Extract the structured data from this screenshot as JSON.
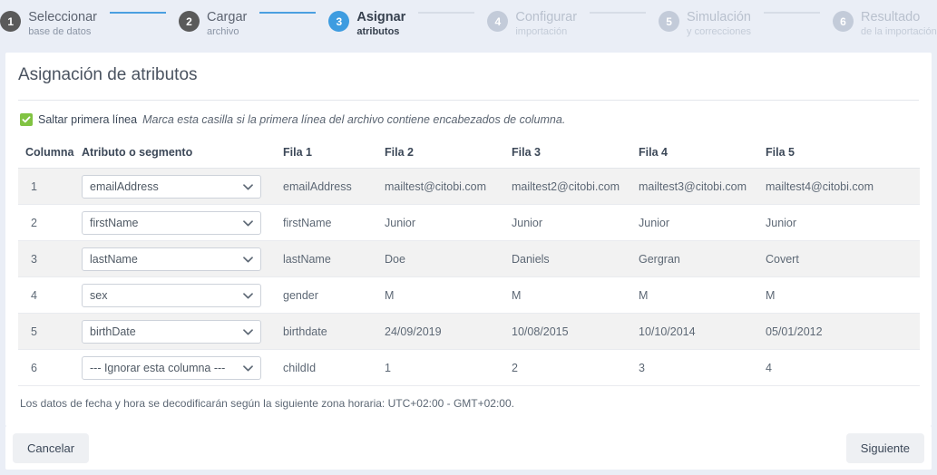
{
  "stepper": {
    "steps": [
      {
        "num": "1",
        "title": "Seleccionar",
        "sub": "base de datos",
        "state": "done"
      },
      {
        "num": "2",
        "title": "Cargar",
        "sub": "archivo",
        "state": "done"
      },
      {
        "num": "3",
        "title": "Asignar",
        "sub": "atributos",
        "state": "active"
      },
      {
        "num": "4",
        "title": "Configurar",
        "sub": "importación",
        "state": "todo"
      },
      {
        "num": "5",
        "title": "Simulación",
        "sub": "y correcciones",
        "state": "todo"
      },
      {
        "num": "6",
        "title": "Resultado",
        "sub": "de la importación",
        "state": "todo"
      }
    ],
    "accent_done": "#4a9fe0",
    "accent_active": "#3e9ce0",
    "accent_todo": "#c3cbd9"
  },
  "page": {
    "title": "Asignación de atributos"
  },
  "skip_first_line": {
    "checked": true,
    "label": "Saltar primera línea",
    "hint": "Marca esta casilla si la primera línea del archivo contiene encabezados de columna.",
    "check_color": "#81c342"
  },
  "table": {
    "headers": [
      "Columna",
      "Atributo o segmento",
      "Fila 1",
      "Fila 2",
      "Fila 3",
      "Fila 4",
      "Fila 5"
    ],
    "rows": [
      {
        "num": "1",
        "attribute": "emailAddress",
        "cells": [
          "emailAddress",
          "mailtest@citobi.com",
          "mailtest2@citobi.com",
          "mailtest3@citobi.com",
          "mailtest4@citobi.com"
        ]
      },
      {
        "num": "2",
        "attribute": "firstName",
        "cells": [
          "firstName",
          "Junior",
          "Junior",
          "Junior",
          "Junior"
        ]
      },
      {
        "num": "3",
        "attribute": "lastName",
        "cells": [
          "lastName",
          "Doe",
          "Daniels",
          "Gergran",
          "Covert"
        ]
      },
      {
        "num": "4",
        "attribute": "sex",
        "cells": [
          "gender",
          "M",
          "M",
          "M",
          "M"
        ]
      },
      {
        "num": "5",
        "attribute": "birthDate",
        "cells": [
          "birthdate",
          "24/09/2019",
          "10/08/2015",
          "10/10/2014",
          "05/01/2012"
        ]
      },
      {
        "num": "6",
        "attribute": "--- Ignorar esta columna ---",
        "cells": [
          "childId",
          "1",
          "2",
          "3",
          "4"
        ]
      }
    ]
  },
  "timezone_note": "Los datos de fecha y hora se decodificarán según la siguiente zona horaria: UTC+02:00 - GMT+02:00.",
  "footer": {
    "cancel_label": "Cancelar",
    "next_label": "Siguiente"
  }
}
